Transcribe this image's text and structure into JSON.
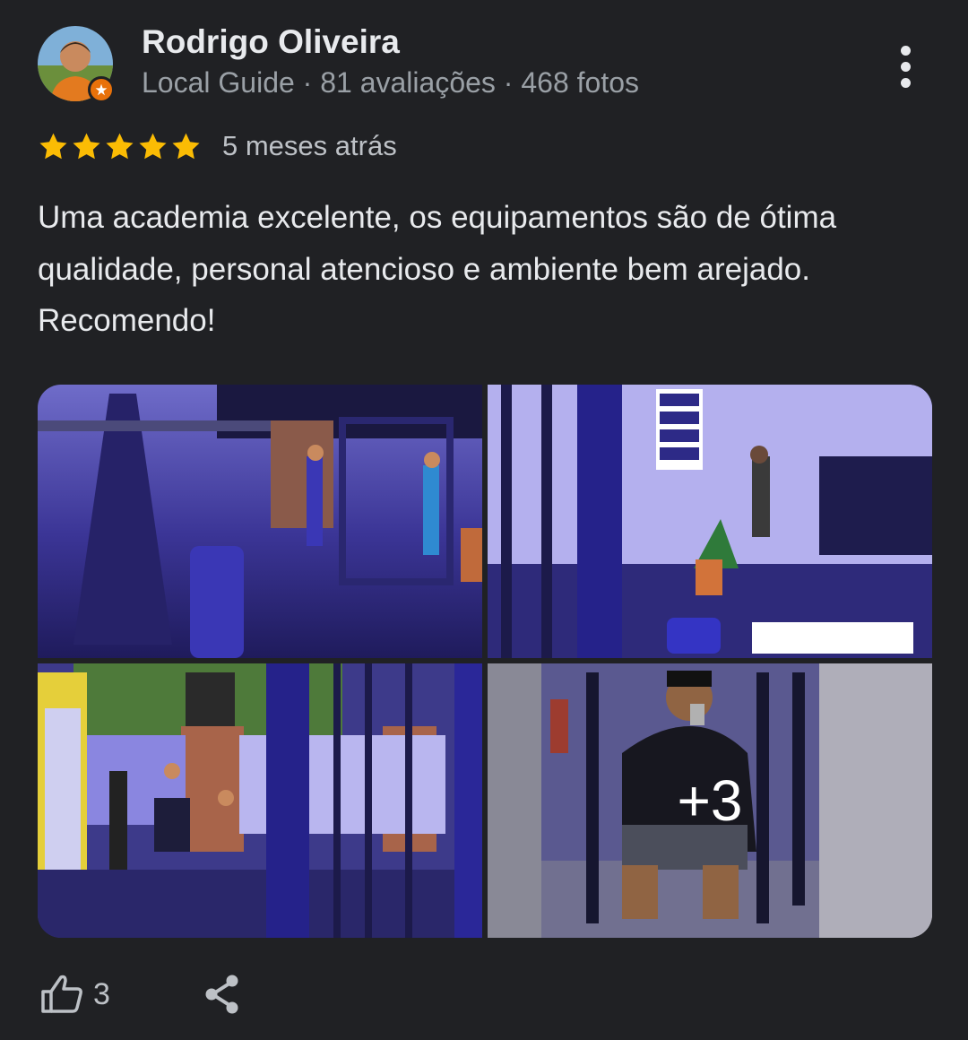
{
  "review": {
    "author_name": "Rodrigo Oliveira",
    "author_meta": "Local Guide · 81 avaliações · 468 fotos",
    "rating": 5,
    "date": "5 meses atrás",
    "text": "Uma academia excelente, os equipamentos são de ótima qualidade, personal atencioso e ambiente bem arejado. Recomendo!"
  },
  "photos": {
    "more_count_label": "+3"
  },
  "actions": {
    "like_count": "3"
  },
  "icons": {
    "avatar": "avatar",
    "badge": "local-guide-badge-icon",
    "more": "more-vert-icon",
    "star": "star-icon",
    "like": "thumb-up-icon",
    "share": "share-icon"
  },
  "colors": {
    "background": "#202124",
    "star": "#fbbc04",
    "guide_badge": "#e8710a",
    "secondary_text": "#9aa0a6"
  }
}
